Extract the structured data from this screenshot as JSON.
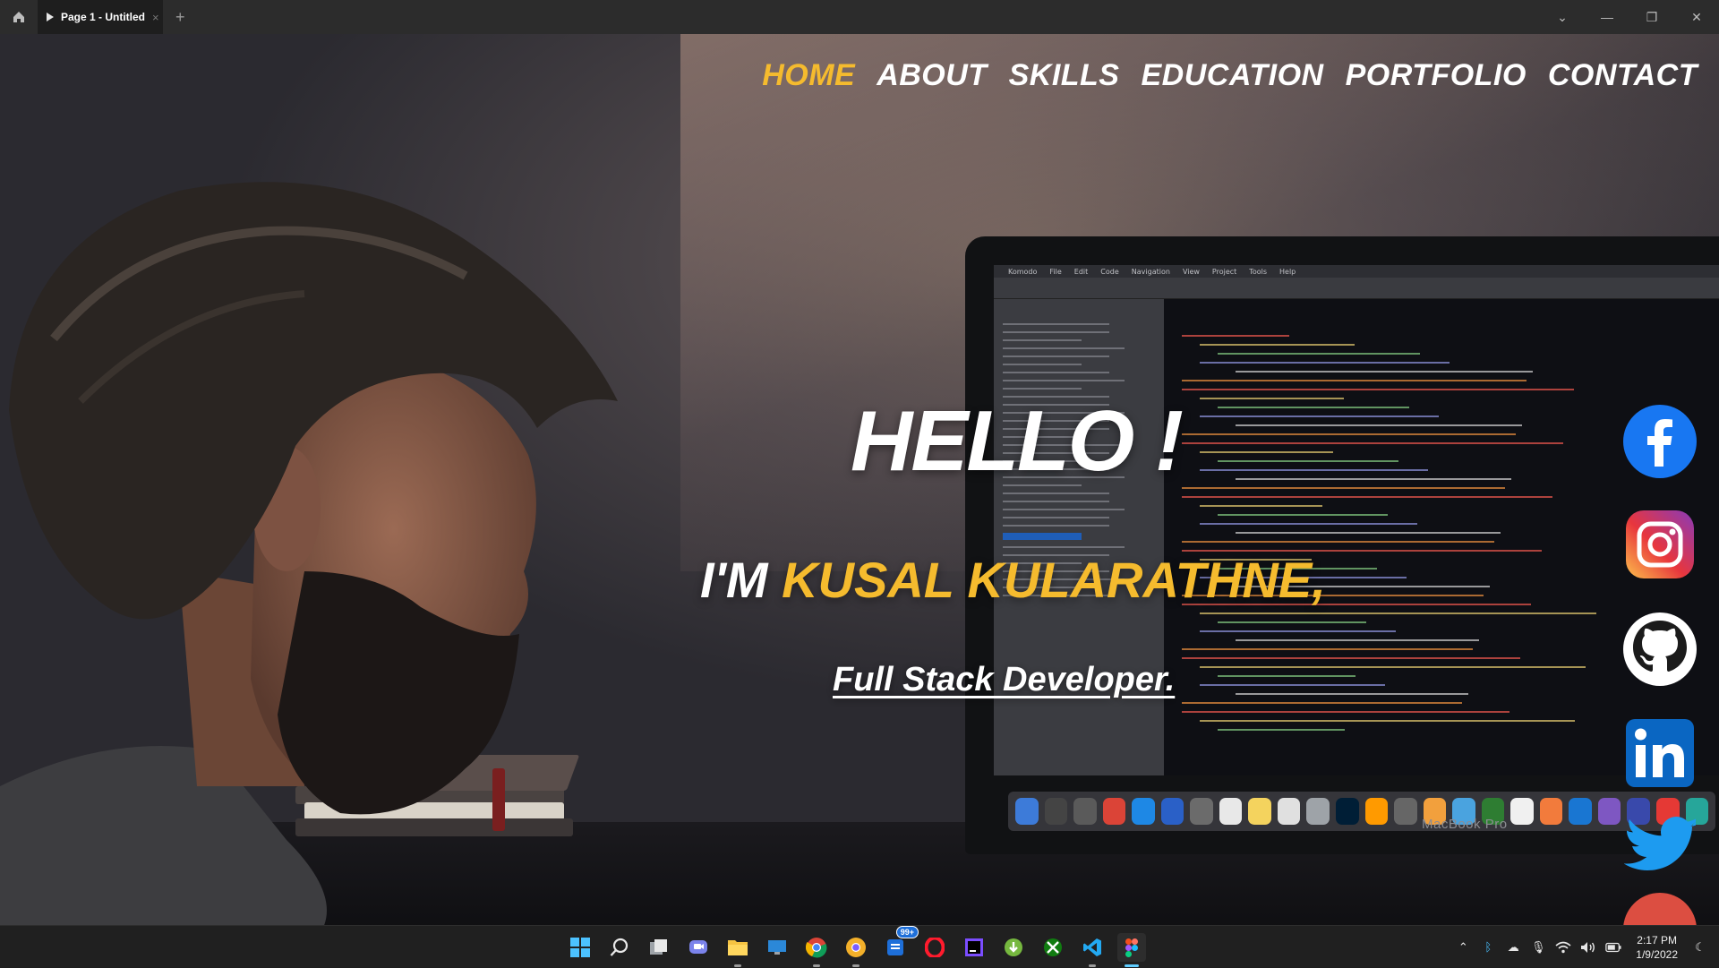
{
  "titlebar": {
    "tab_title": "Page 1 - Untitled",
    "tab_close": "×",
    "new_tab": "+",
    "minimize": "—",
    "maximize": "❐",
    "close": "✕",
    "dropdown": "⌄"
  },
  "nav": {
    "items": [
      {
        "label": "HOME",
        "active": true
      },
      {
        "label": "ABOUT",
        "active": false
      },
      {
        "label": "SKILLS",
        "active": false
      },
      {
        "label": "EDUCATION",
        "active": false
      },
      {
        "label": "PORTFOLIO",
        "active": false
      },
      {
        "label": "CONTACT",
        "active": false
      }
    ]
  },
  "hero": {
    "greeting": "HELLO !",
    "intro_prefix": "I'M ",
    "name": "KUSAL KULARATHNE,",
    "role": "Full Stack Developer."
  },
  "laptop": {
    "label": "MacBook Pro",
    "menu": [
      "Komodo",
      "File",
      "Edit",
      "Code",
      "Navigation",
      "View",
      "Project",
      "Tools",
      "Help"
    ]
  },
  "socials": [
    "facebook-icon",
    "instagram-icon",
    "github-icon",
    "linkedin-icon",
    "twitter-icon",
    "google-plus-icon"
  ],
  "taskbar": {
    "badge": "99+",
    "time": "2:17 PM",
    "date": "1/9/2022"
  },
  "colors": {
    "accent": "#f5bb2e",
    "text": "#ffffff",
    "facebook": "#1877f2",
    "linkedin": "#0a66c2",
    "twitter": "#1d9bf0"
  }
}
